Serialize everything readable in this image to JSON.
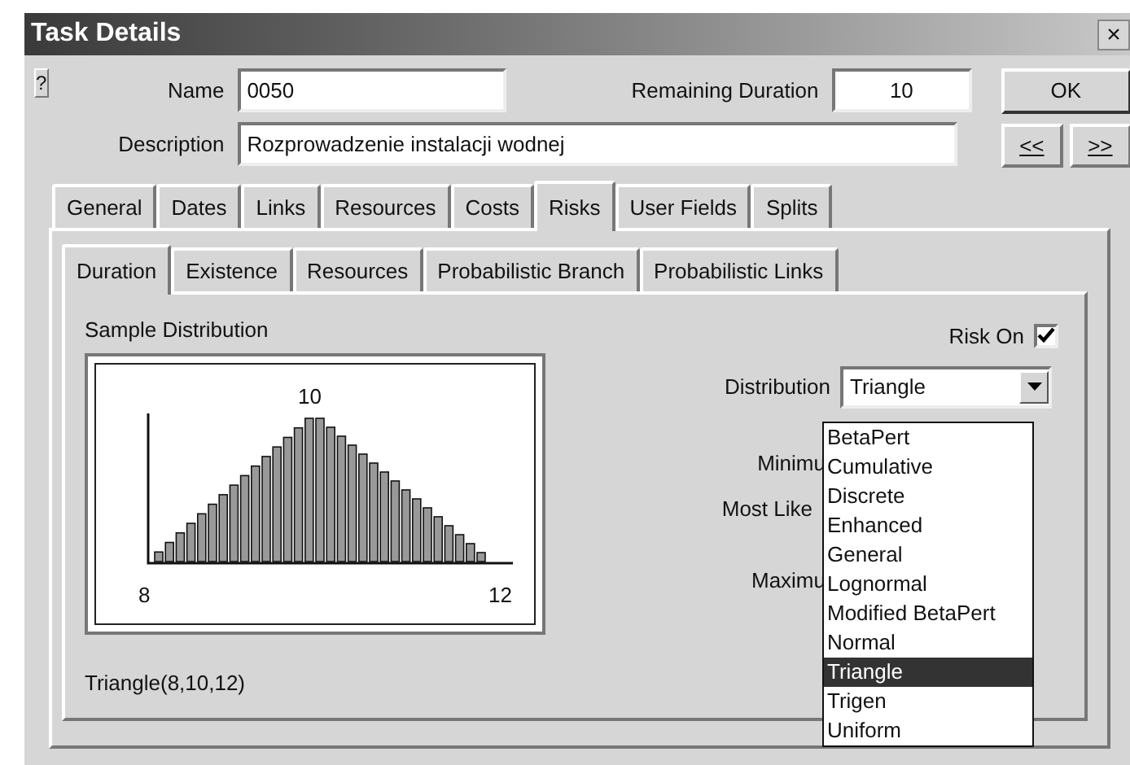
{
  "window": {
    "title": "Task Details",
    "help": "?",
    "close": "×"
  },
  "fields": {
    "name_label": "Name",
    "name": "0050",
    "remaining_label": "Remaining Duration",
    "remaining": "10",
    "description_label": "Description",
    "description": "Rozprowadzenie instalacji wodnej"
  },
  "buttons": {
    "ok": "OK",
    "prev": "<<",
    "next": ">>"
  },
  "tabs": [
    {
      "label": "General",
      "selected": false
    },
    {
      "label": "Dates",
      "selected": false
    },
    {
      "label": "Links",
      "selected": false
    },
    {
      "label": "Resources",
      "selected": false
    },
    {
      "label": "Costs",
      "selected": false
    },
    {
      "label": "Risks",
      "selected": true
    },
    {
      "label": "User Fields",
      "selected": false
    },
    {
      "label": "Splits",
      "selected": false
    }
  ],
  "subtabs": [
    {
      "label": "Duration",
      "selected": true
    },
    {
      "label": "Existence",
      "selected": false
    },
    {
      "label": "Resources",
      "selected": false
    },
    {
      "label": "Probabilistic Branch",
      "selected": false
    },
    {
      "label": "Probabilistic Links",
      "selected": false
    }
  ],
  "sample": {
    "title": "Sample Distribution",
    "peak_label": "10",
    "min_label": "8",
    "max_label": "12",
    "formula": "Triangle(8,10,12)"
  },
  "risk_on": {
    "label": "Risk On",
    "checked": true
  },
  "distribution": {
    "label": "Distribution",
    "value": "Triangle",
    "options": [
      {
        "label": "BetaPert",
        "selected": false
      },
      {
        "label": "Cumulative",
        "selected": false
      },
      {
        "label": "Discrete",
        "selected": false
      },
      {
        "label": "Enhanced",
        "selected": false
      },
      {
        "label": "General",
        "selected": false
      },
      {
        "label": "Lognormal",
        "selected": false
      },
      {
        "label": "Modified BetaPert",
        "selected": false
      },
      {
        "label": "Normal",
        "selected": false
      },
      {
        "label": "Triangle",
        "selected": true
      },
      {
        "label": "Trigen",
        "selected": false
      },
      {
        "label": "Uniform",
        "selected": false
      }
    ]
  },
  "params": [
    {
      "label": "Minimu"
    },
    {
      "label": "Most Like"
    },
    {
      "label": "Maximu"
    }
  ]
}
